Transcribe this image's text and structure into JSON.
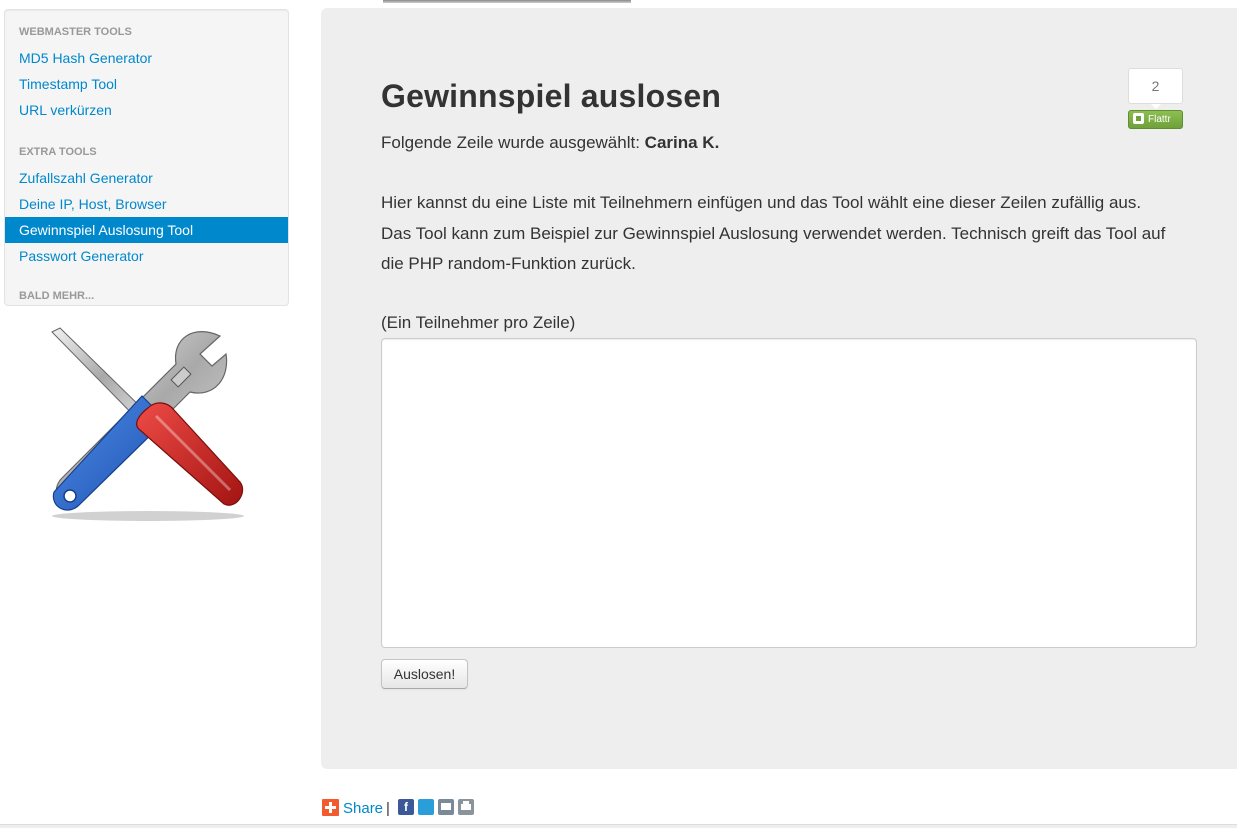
{
  "sidebar": {
    "sections": [
      {
        "header": "WEBMASTER TOOLS",
        "items": [
          {
            "label": "MD5 Hash Generator"
          },
          {
            "label": "Timestamp Tool"
          },
          {
            "label": "URL verkürzen"
          }
        ]
      },
      {
        "header": "EXTRA TOOLS",
        "items": [
          {
            "label": "Zufallszahl Generator"
          },
          {
            "label": "Deine IP, Host, Browser"
          },
          {
            "label": "Gewinnspiel Auslosung Tool",
            "active": true
          },
          {
            "label": "Passwort Generator"
          }
        ]
      }
    ],
    "more_label": "BALD MEHR..."
  },
  "main": {
    "title": "Gewinnspiel auslosen",
    "result_prefix": "Folgende Zeile wurde ausgewählt:",
    "result_value": "Carina K.",
    "description": "Hier kannst du eine Liste mit Teilnehmern einfügen und das Tool wählt eine dieser Zeilen zufällig aus. Das Tool kann zum Beispiel zur Gewinnspiel Auslosung verwendet werden. Technisch greift das Tool auf die PHP random-Funktion zurück.",
    "field_label": "(Ein Teilnehmer pro Zeile)",
    "textarea_value": "",
    "button_label": "Auslosen!"
  },
  "flattr": {
    "count": "2",
    "button_label": "Flattr"
  },
  "share": {
    "label": "Share",
    "separator": "|",
    "icons": [
      "share-plus-icon",
      "facebook-icon",
      "twitter-icon",
      "email-icon",
      "print-icon"
    ]
  },
  "colors": {
    "link": "#0088cc",
    "active_bg": "#0088cc",
    "panel_bg": "#eeeeee",
    "sidebar_bg": "#f5f5f5",
    "flattr_green": "#6fa03a"
  }
}
